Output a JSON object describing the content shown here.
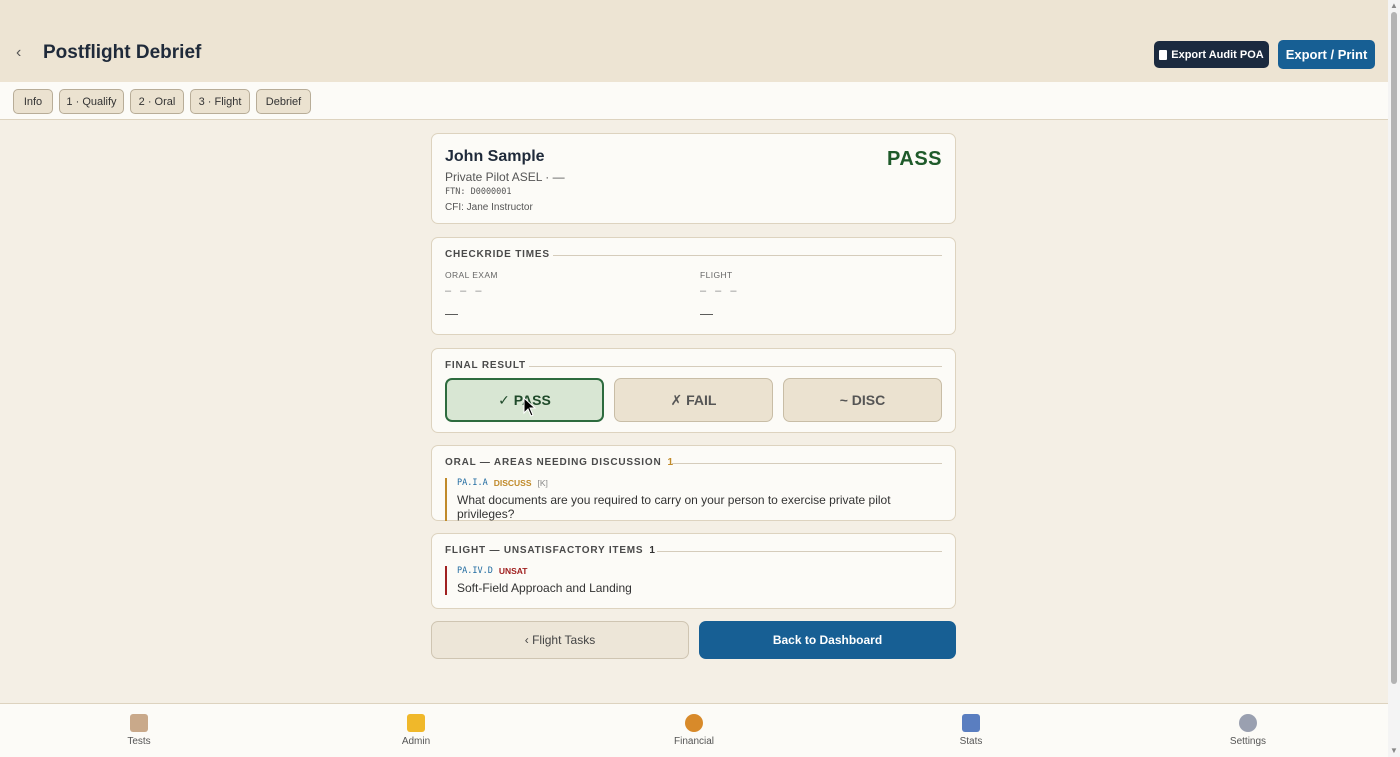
{
  "header": {
    "back_icon": "chevron-left-icon",
    "title": "Postflight Debrief",
    "audit_button": "Export Audit POA",
    "export_button": "Export / Print"
  },
  "tabs": [
    "Info",
    "1 · Qualify",
    "2 · Oral",
    "3 · Flight",
    "Debrief"
  ],
  "pilot": {
    "name": "John Sample",
    "certificate": "Private Pilot ASEL · —",
    "ftn": "FTN: D0000001",
    "cfi": "CFI: Jane Instructor",
    "result_badge": "PASS"
  },
  "checkride_times": {
    "title": "CHECKRIDE TIMES",
    "oral_label": "ORAL EXAM",
    "oral_range": "– – –",
    "oral_value": "—",
    "flight_label": "FLIGHT",
    "flight_range": "– – –",
    "flight_value": "—"
  },
  "final_result": {
    "title": "FINAL RESULT",
    "pass_label": "✓ PASS",
    "fail_label": "✗ FAIL",
    "disc_label": "~ DISC",
    "selected": "PASS"
  },
  "oral_discussion": {
    "title": "ORAL — AREAS NEEDING DISCUSSION",
    "count": "1",
    "item_code": "PA.I.A",
    "item_status": "DISCUSS",
    "item_tag": "[K]",
    "item_text": "What documents are you required to carry on your person to exercise private pilot privileges?"
  },
  "flight_unsat": {
    "title": "FLIGHT — UNSATISFACTORY ITEMS",
    "count": "1",
    "item_code": "PA.IV.D",
    "item_status": "UNSAT",
    "item_text": "Soft-Field Approach and Landing"
  },
  "buttons": {
    "flight_tasks": "‹ Flight Tasks",
    "dashboard": "Back to Dashboard"
  },
  "bottom_nav": [
    {
      "label": "Tests",
      "icon": "clipboard-icon",
      "color": "#c9a98a"
    },
    {
      "label": "Admin",
      "icon": "folder-icon",
      "color": "#f0b82a"
    },
    {
      "label": "Financial",
      "icon": "money-bag-icon",
      "color": "#d88a2a"
    },
    {
      "label": "Stats",
      "icon": "bar-chart-icon",
      "color": "#5a7ec0"
    },
    {
      "label": "Settings",
      "icon": "gear-icon",
      "color": "#9aa0b0"
    }
  ],
  "colors": {
    "header_bg": "#ede4d3",
    "primary": "#175f94",
    "pass_green": "#1e5a2a",
    "discuss_amber": "#c08a2a",
    "unsat_red": "#a02020"
  }
}
